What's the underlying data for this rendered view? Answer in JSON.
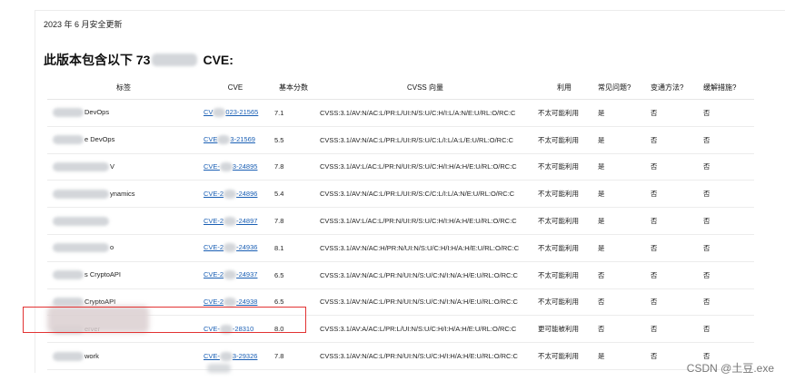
{
  "release_title": "2023 年 6 月安全更新",
  "heading": {
    "prefix": "此版本包含以下 73",
    "suffix": "CVE:"
  },
  "columns": [
    "标签",
    "CVE",
    "基本分数",
    "CVSS 向量",
    "利用",
    "常见问题?",
    "变通方法?",
    "缓解措施?"
  ],
  "rows": [
    {
      "tag": "DevOps",
      "cve_prefix": "CV",
      "cve_suffix": "023-21565",
      "score": "7.1",
      "vector": "CVSS:3.1/AV:N/AC:L/PR:L/UI:N/S:U/C:H/I:L/A:N/E:U/RL:O/RC:C",
      "exploit": "不太可能利用",
      "faq": "是",
      "workaround": "否",
      "mitigation": "否"
    },
    {
      "tag": "e DevOps",
      "cve_prefix": "CVE",
      "cve_suffix": "3-21569",
      "score": "5.5",
      "vector": "CVSS:3.1/AV:N/AC:L/PR:L/UI:R/S:U/C:L/I:L/A:L/E:U/RL:O/RC:C",
      "exploit": "不太可能利用",
      "faq": "是",
      "workaround": "否",
      "mitigation": "否"
    },
    {
      "tag": "V",
      "cve_prefix": "CVE-",
      "cve_suffix": "3-24895",
      "score": "7.8",
      "vector": "CVSS:3.1/AV:L/AC:L/PR:N/UI:R/S:U/C:H/I:H/A:H/E:U/RL:O/RC:C",
      "exploit": "不太可能利用",
      "faq": "是",
      "workaround": "否",
      "mitigation": "否"
    },
    {
      "tag": "ynamics",
      "cve_prefix": "CVE-2",
      "cve_suffix": "-24896",
      "score": "5.4",
      "vector": "CVSS:3.1/AV:N/AC:L/PR:L/UI:R/S:C/C:L/I:L/A:N/E:U/RL:O/RC:C",
      "exploit": "不太可能利用",
      "faq": "是",
      "workaround": "否",
      "mitigation": "否"
    },
    {
      "tag": "",
      "cve_prefix": "CVE-2",
      "cve_suffix": "-24897",
      "score": "7.8",
      "vector": "CVSS:3.1/AV:L/AC:L/PR:N/UI:R/S:U/C:H/I:H/A:H/E:U/RL:O/RC:C",
      "exploit": "不太可能利用",
      "faq": "是",
      "workaround": "否",
      "mitigation": "否"
    },
    {
      "tag": "o",
      "cve_prefix": "CVE-2",
      "cve_suffix": "-24936",
      "score": "8.1",
      "vector": "CVSS:3.1/AV:N/AC:H/PR:N/UI:N/S:U/C:H/I:H/A:H/E:U/RL:O/RC:C",
      "exploit": "不太可能利用",
      "faq": "是",
      "workaround": "否",
      "mitigation": "否"
    },
    {
      "tag": "s CryptoAPI",
      "cve_prefix": "CVE-2",
      "cve_suffix": "-24937",
      "score": "6.5",
      "vector": "CVSS:3.1/AV:N/AC:L/PR:N/UI:N/S:U/C:N/I:N/A:H/E:U/RL:O/RC:C",
      "exploit": "不太可能利用",
      "faq": "否",
      "workaround": "否",
      "mitigation": "否"
    },
    {
      "tag": "CryptoAPI",
      "cve_prefix": "CVE-2",
      "cve_suffix": "-24938",
      "score": "6.5",
      "vector": "CVSS:3.1/AV:N/AC:L/PR:N/UI:N/S:U/C:N/I:N/A:H/E:U/RL:O/RC:C",
      "exploit": "不太可能利用",
      "faq": "否",
      "workaround": "否",
      "mitigation": "否"
    },
    {
      "tag": "erver",
      "cve_prefix": "CVE-",
      "cve_suffix": "-28310",
      "score": "8.0",
      "vector": "CVSS:3.1/AV:A/AC:L/PR:L/UI:N/S:U/C:H/I:H/A:H/E:U/RL:O/RC:C",
      "exploit": "更可能被利用",
      "faq": "否",
      "workaround": "否",
      "mitigation": "否"
    },
    {
      "tag": "work",
      "cve_prefix": "CVE-",
      "cve_suffix": "3-29326",
      "score": "7.8",
      "vector": "CVSS:3.1/AV:N/AC:L/PR:N/UI:N/S:U/C:H/I:H/A:H/E:U/RL:O/RC:C",
      "exploit": "不太可能利用",
      "faq": "是",
      "workaround": "否",
      "mitigation": "否"
    }
  ],
  "watermark": "CSDN @土豆.exe",
  "colors": {
    "link": "#1a5fb4",
    "highlight": "#e23232"
  }
}
